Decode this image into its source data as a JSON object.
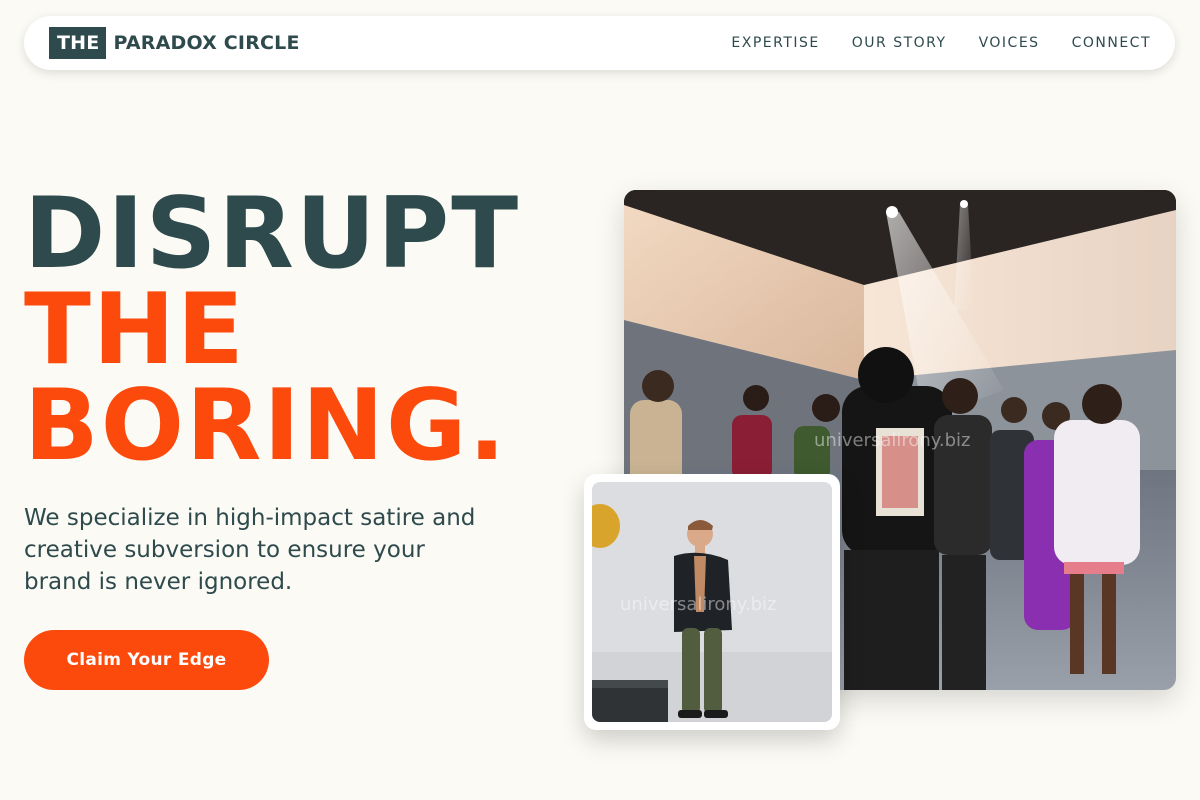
{
  "brand": {
    "box_text": "THE",
    "name": "PARADOX CIRCLE"
  },
  "nav": {
    "items": [
      {
        "label": "EXPERTISE"
      },
      {
        "label": "OUR STORY"
      },
      {
        "label": "VOICES"
      },
      {
        "label": "CONNECT"
      }
    ]
  },
  "hero": {
    "line1": "DISRUPT",
    "line2": "THE",
    "line3": "BORING.",
    "description": "We specialize in high-impact satire and creative subversion to ensure your brand is never ignored.",
    "cta_label": "Claim Your Edge"
  },
  "images": {
    "main_watermark": "universalirony.biz",
    "sub_watermark": "universalirony.biz"
  },
  "colors": {
    "background": "#fbfaf4",
    "primary_dark": "#2e4a4d",
    "accent": "#fc4a0d",
    "white": "#ffffff"
  }
}
